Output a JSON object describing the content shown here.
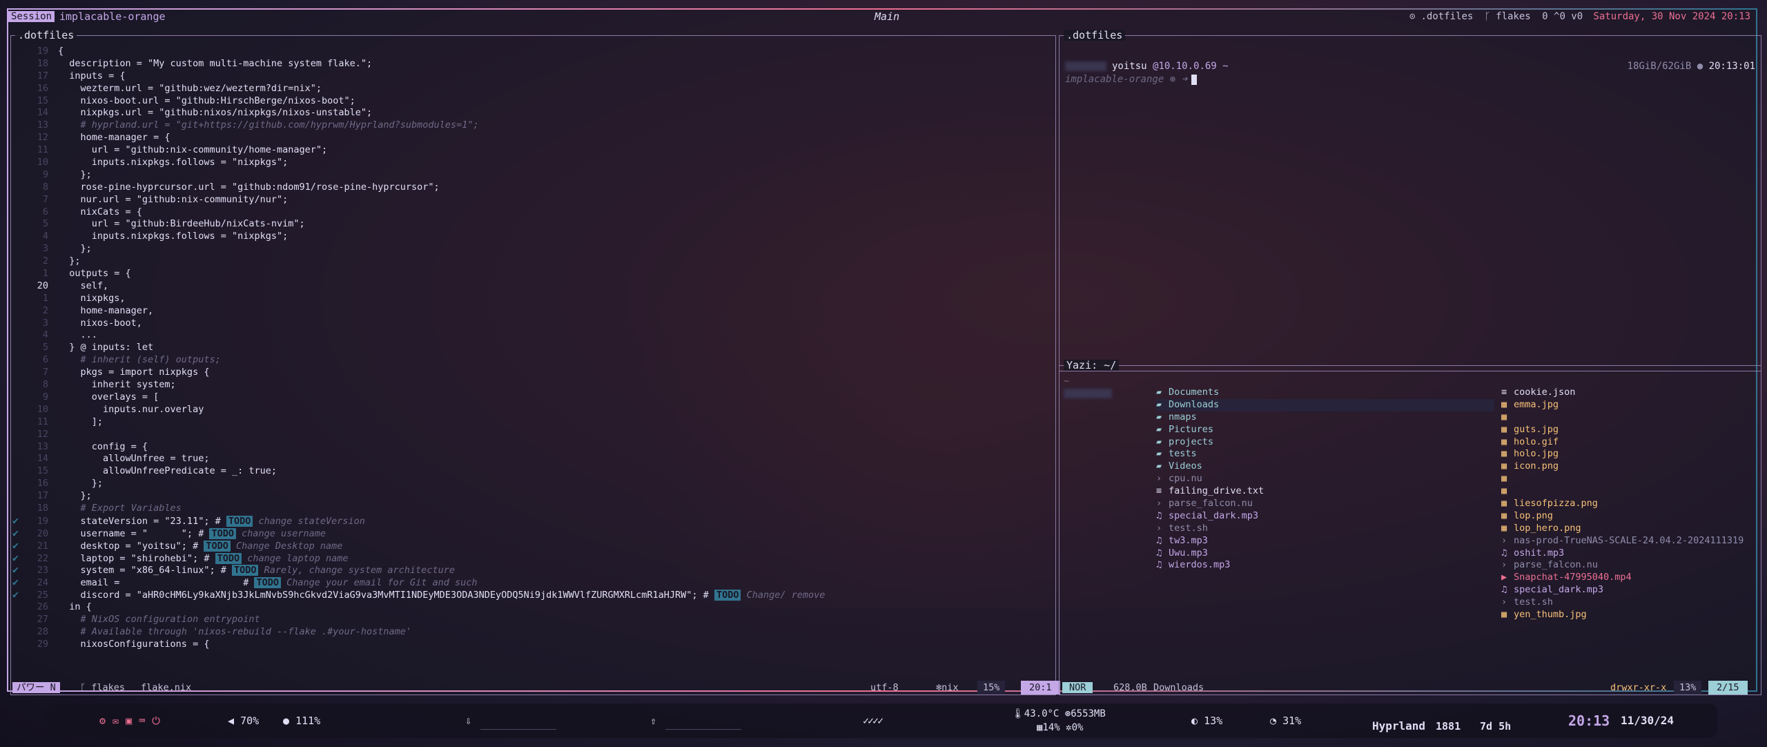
{
  "topbar": {
    "session_tag": "Session",
    "session_name": "implacable-orange",
    "tab_title": "Main",
    "git_repo": ".dotfiles",
    "git_branch": "flakes",
    "git_counts": "0 ^0 v0",
    "datetime": "Saturday, 30 Nov 2024 20:13"
  },
  "editor": {
    "title": ".dotfiles",
    "lines": [
      {
        "ln": "19",
        "t": "{"
      },
      {
        "ln": "18",
        "t": "  description = \"My custom multi-machine system flake.\";"
      },
      {
        "ln": "17",
        "t": "  inputs = {"
      },
      {
        "ln": "16",
        "t": "    wezterm.url = \"github:wez/wezterm?dir=nix\";"
      },
      {
        "ln": "15",
        "t": "    nixos-boot.url = \"github:HirschBerge/nixos-boot\";"
      },
      {
        "ln": "14",
        "t": "    nixpkgs.url = \"github:nixos/nixpkgs/nixos-unstable\";"
      },
      {
        "ln": "13",
        "t": "    # hyprland.url = \"git+https://github.com/hyprwm/Hyprland?submodules=1\";",
        "c": true
      },
      {
        "ln": "12",
        "t": "    home-manager = {"
      },
      {
        "ln": "11",
        "t": "      url = \"github:nix-community/home-manager\";"
      },
      {
        "ln": "10",
        "t": "      inputs.nixpkgs.follows = \"nixpkgs\";"
      },
      {
        "ln": "9",
        "t": "    };"
      },
      {
        "ln": "8",
        "t": "    rose-pine-hyprcursor.url = \"github:ndom91/rose-pine-hyprcursor\";"
      },
      {
        "ln": "7",
        "t": "    nur.url = \"github:nix-community/nur\";"
      },
      {
        "ln": "6",
        "t": "    nixCats = {"
      },
      {
        "ln": "5",
        "t": "      url = \"github:BirdeeHub/nixCats-nvim\";"
      },
      {
        "ln": "4",
        "t": "      inputs.nixpkgs.follows = \"nixpkgs\";"
      },
      {
        "ln": "3",
        "t": "    };"
      },
      {
        "ln": "2",
        "t": "  };"
      },
      {
        "ln": "1",
        "t": "  outputs = {"
      },
      {
        "ln": "20",
        "t": "    self,",
        "cur": true
      },
      {
        "ln": "1",
        "t": "    nixpkgs,"
      },
      {
        "ln": "2",
        "t": "    home-manager,"
      },
      {
        "ln": "3",
        "t": "    nixos-boot,"
      },
      {
        "ln": "4",
        "t": "    ..."
      },
      {
        "ln": "5",
        "t": "  } @ inputs: let"
      },
      {
        "ln": "6",
        "t": "    # inherit (self) outputs;",
        "c": true
      },
      {
        "ln": "7",
        "t": "    pkgs = import nixpkgs {"
      },
      {
        "ln": "8",
        "t": "      inherit system;"
      },
      {
        "ln": "9",
        "t": "      overlays = ["
      },
      {
        "ln": "10",
        "t": "        inputs.nur.overlay"
      },
      {
        "ln": "11",
        "t": "      ];"
      },
      {
        "ln": "12",
        "t": ""
      },
      {
        "ln": "13",
        "t": "      config = {"
      },
      {
        "ln": "14",
        "t": "        allowUnfree = true;"
      },
      {
        "ln": "15",
        "t": "        allowUnfreePredicate = _: true;"
      },
      {
        "ln": "16",
        "t": "      };"
      },
      {
        "ln": "17",
        "t": "    };"
      },
      {
        "ln": "18",
        "t": "    # Export Variables",
        "c": true
      },
      {
        "ln": "19",
        "t": "    stateVersion = \"23.11\"; # ",
        "todo": "TODO",
        "after": " change stateVersion",
        "chk": true
      },
      {
        "ln": "20",
        "t": "    username = \"      \"; # ",
        "todo": "TODO",
        "after": " change username",
        "chk": true
      },
      {
        "ln": "21",
        "t": "    desktop = \"yoitsu\"; # ",
        "todo": "TODO",
        "after": " Change Desktop name",
        "chk": true
      },
      {
        "ln": "22",
        "t": "    laptop = \"shirohebi\"; # ",
        "todo": "TODO",
        "after": " change laptop name",
        "chk": true
      },
      {
        "ln": "23",
        "t": "    system = \"x86_64-linux\"; # ",
        "todo": "TODO",
        "after": " Rarely, change system architecture",
        "chk": true
      },
      {
        "ln": "24",
        "t": "    email =                      # ",
        "todo": "TODO",
        "after": " Change your email for Git and such",
        "chk": true
      },
      {
        "ln": "25",
        "t": "    discord = \"aHR0cHM6Ly9kaXNjb3JkLmNvbS9hcGkvd2ViaG9va3MvMTI1NDEyMDE3ODA3NDEyODQ5Ni9jdk1WWVlfZURGMXRLcmR1aHJRW\"; # ",
        "todo": "TODO",
        "after": " Change/ remove",
        "chk": true
      },
      {
        "ln": "26",
        "t": "  in {"
      },
      {
        "ln": "27",
        "t": "    # NixOS configuration entrypoint",
        "c": true
      },
      {
        "ln": "28",
        "t": "    # Available through 'nixos-rebuild --flake .#your-hostname'",
        "c": true
      },
      {
        "ln": "29",
        "t": "    nixosConfigurations = {"
      }
    ],
    "status": {
      "mode": "パワー N",
      "branch": "flakes",
      "file": "flake.nix",
      "encoding": "utf-8",
      "filetype": "nix",
      "percent": "15%",
      "position": "20:1"
    }
  },
  "shell": {
    "title": ".dotfiles",
    "user": "yoitsu",
    "host": "@10.10.0.69 ~",
    "session": "implacable-orange",
    "prompt_symbol": "➜",
    "mem": "18GiB/62GiB",
    "time": "20:13:01"
  },
  "yazi": {
    "title": "Yazi: ~/",
    "parent_marker": "~",
    "middle": [
      {
        "n": "Documents",
        "k": "dir"
      },
      {
        "n": "Downloads",
        "k": "dir",
        "sel": true
      },
      {
        "n": "nmaps",
        "k": "dir"
      },
      {
        "n": "Pictures",
        "k": "dir"
      },
      {
        "n": "projects",
        "k": "dir"
      },
      {
        "n": "tests",
        "k": "dir"
      },
      {
        "n": "Videos",
        "k": "dir"
      },
      {
        "n": "cpu.nu",
        "k": "sh"
      },
      {
        "n": "failing_drive.txt",
        "k": "txtf"
      },
      {
        "n": "parse_falcon.nu",
        "k": "sh"
      },
      {
        "n": "special_dark.mp3",
        "k": "mp3"
      },
      {
        "n": "test.sh",
        "k": "sh"
      },
      {
        "n": "tw3.mp3",
        "k": "mp3"
      },
      {
        "n": "Uwu.mp3",
        "k": "mp3"
      },
      {
        "n": "wierdos.mp3",
        "k": "mp3"
      }
    ],
    "right": [
      {
        "n": "cookie.json",
        "k": "txtf"
      },
      {
        "n": "emma.jpg",
        "k": "img"
      },
      {
        "n": "",
        "k": "img"
      },
      {
        "n": "guts.jpg",
        "k": "img"
      },
      {
        "n": "holo.gif",
        "k": "img"
      },
      {
        "n": "holo.jpg",
        "k": "img"
      },
      {
        "n": "icon.png",
        "k": "img"
      },
      {
        "n": "",
        "k": "img"
      },
      {
        "n": "",
        "k": "img"
      },
      {
        "n": "liesofpizza.png",
        "k": "img"
      },
      {
        "n": "lop.png",
        "k": "img"
      },
      {
        "n": "lop_hero.png",
        "k": "img"
      },
      {
        "n": "nas-prod-TrueNAS-SCALE-24.04.2-2024111319",
        "k": "sh"
      },
      {
        "n": "oshit.mp3",
        "k": "mp3"
      },
      {
        "n": "parse_falcon.nu",
        "k": "sh"
      },
      {
        "n": "Snapchat-47995040.mp4",
        "k": "vid"
      },
      {
        "n": "special_dark.mp3",
        "k": "mp3"
      },
      {
        "n": "test.sh",
        "k": "sh"
      },
      {
        "n": "yen_thumb.jpg",
        "k": "img"
      }
    ],
    "status": {
      "mode": "NOR",
      "size": "628.0B",
      "dir": "Downloads",
      "perm": "drwxr-xr-x",
      "percent": "13%",
      "count": "2/15"
    }
  },
  "bar": {
    "volume": "70%",
    "mic": "111%",
    "temp": "43.0°C",
    "mem": "6553MB",
    "cpu": "14%",
    "gpu": "0%",
    "brightness": "13%",
    "battery": "31%",
    "wm": "Hyprland",
    "packages": "1881",
    "uptime": "7d 5h",
    "clock": "20:13",
    "date": "11/30/24",
    "checks": "✓✓✓✓"
  }
}
